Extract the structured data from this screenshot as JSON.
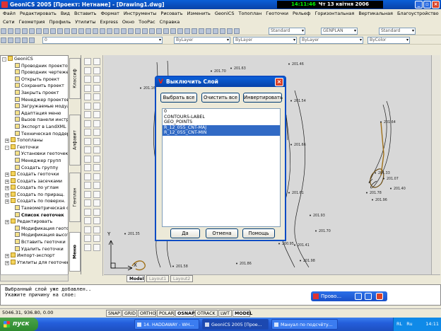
{
  "window": {
    "title": "GeoniCS 2005 [Проект: Нетнаме] - [Drawing1.dwg]",
    "clock_time": "14:11:46",
    "clock_date": "Чт 13 квітня 2006"
  },
  "menu_main": [
    "Файл",
    "Редактировать",
    "Вид",
    "Вставить",
    "Формат",
    "Инструменты",
    "Рисовать",
    "Изменить",
    "GeoniCS",
    "Топоплан",
    "Геоточки",
    "Рельеф",
    "Горизонтальная",
    "Вертикальная",
    "Благоустройство"
  ],
  "menu_secondary": [
    "Сети",
    "Геометрия",
    "Профиль",
    "Утилиты",
    "Express",
    "Окно",
    "ТооРас",
    "Справка"
  ],
  "toolbar": {
    "layer_combo": "0",
    "textstyle_combo": "Standard",
    "dimstyle_combo": "GENPLAN",
    "tablestyle_combo": "Standard",
    "color_combo": "ByLayer",
    "linetype_combo": "ByLayer",
    "lineweight_combo": "ByLayer",
    "plotstyle_combo": "ByColor"
  },
  "tree": [
    {
      "label": "GeoniCS",
      "type": "folder",
      "expand": "-"
    },
    {
      "label": "Проводник проектов",
      "type": "item"
    },
    {
      "label": "Проводник чертежей",
      "type": "item"
    },
    {
      "label": "Открыть проект",
      "type": "item"
    },
    {
      "label": "Сохранить проект",
      "type": "item"
    },
    {
      "label": "Закрыть проект",
      "type": "item"
    },
    {
      "label": "Менеджер проектов",
      "type": "item"
    },
    {
      "label": "Загружаемые модули",
      "type": "item"
    },
    {
      "label": "Адаптация меню",
      "type": "item"
    },
    {
      "label": "Вызов панели инструм.",
      "type": "item"
    },
    {
      "label": "Экспорт в LandXML",
      "type": "item"
    },
    {
      "label": "Техническая поддержка",
      "type": "item"
    },
    {
      "label": "Топопланы",
      "type": "folder",
      "expand": "+"
    },
    {
      "label": "Геоточки",
      "type": "folder",
      "expand": "-"
    },
    {
      "label": "Установки геоточек",
      "type": "item"
    },
    {
      "label": "Менеджер групп",
      "type": "item"
    },
    {
      "label": "Создать группу",
      "type": "item"
    },
    {
      "label": "Создать геоточки",
      "type": "folder",
      "expand": "+"
    },
    {
      "label": "Создать засечками",
      "type": "folder",
      "expand": "+"
    },
    {
      "label": "Создать по углам",
      "type": "folder",
      "expand": "+"
    },
    {
      "label": "Создать по приращ.",
      "type": "folder",
      "expand": "+"
    },
    {
      "label": "Создать по поверхн.",
      "type": "folder",
      "expand": "+"
    },
    {
      "label": "Тахеометрическая съёмка",
      "type": "item"
    },
    {
      "label": "Список геоточек",
      "type": "item",
      "bold": true
    },
    {
      "label": "Редактировать",
      "type": "folder",
      "expand": "+"
    },
    {
      "label": "Модификация геоточек",
      "type": "item"
    },
    {
      "label": "Модификация высот",
      "type": "item"
    },
    {
      "label": "Вставить геоточки",
      "type": "item"
    },
    {
      "label": "Удалить геоточки",
      "type": "item"
    },
    {
      "label": "Импорт-экспорт",
      "type": "folder",
      "expand": "+"
    },
    {
      "label": "Утилиты для геоточек",
      "type": "folder",
      "expand": "+"
    }
  ],
  "vertical_tabs": [
    "Классиф",
    "Алфавит",
    "Генплан",
    "Меню"
  ],
  "drawing": {
    "elevations": [
      "201.70",
      "201.63",
      "201.46",
      "201.54",
      "201.16",
      "201.66",
      "201.61",
      "201.64",
      "201.33",
      "201.07",
      "201.40",
      "201.78",
      "201.93",
      "201.70",
      "200.95",
      "200.90",
      "201.35",
      "201.41",
      "201.58",
      "201.86",
      "201.98",
      "201.96"
    ],
    "ucs_x": "X",
    "ucs_y": "Y"
  },
  "layout_tabs": [
    "Model",
    "Layout1",
    "Layout2"
  ],
  "dialog": {
    "title": "Выключить Слой",
    "btn_select_all": "Выбрать все",
    "btn_clear_all": "Очистить все",
    "btn_invert": "Инвертировать",
    "layers": [
      {
        "name": "0",
        "selected": false
      },
      {
        "name": "CONTOURS-LABEL",
        "selected": false
      },
      {
        "name": "GEO_POINTS",
        "selected": false
      },
      {
        "name": "R_12_055_CNT-MAJ",
        "selected": true
      },
      {
        "name": "R_12_055_CNT-MIN",
        "selected": true
      }
    ],
    "btn_ok": "Да",
    "btn_cancel": "Отмена",
    "btn_help": "Помощь"
  },
  "command_lines": [
    "Выбранный слой уже добавлен..",
    "Укажите причину на слое:"
  ],
  "floating_window_title": "Прово...",
  "status": {
    "coords": "5046.31, 936.80, 0.00",
    "buttons": [
      "SNAP",
      "GRID",
      "ORTHO",
      "POLAR",
      "OSNAP",
      "OTRACK",
      "LWT",
      "MODEL"
    ]
  },
  "taskbar": {
    "start": "пуск",
    "tasks": [
      "14. HADDAWAY - WH...",
      "GeoniCS 2005 [Прое...",
      "Мануал по подсчёту..."
    ],
    "lang": "RL",
    "lang2": "Ru",
    "time": "14:11"
  }
}
